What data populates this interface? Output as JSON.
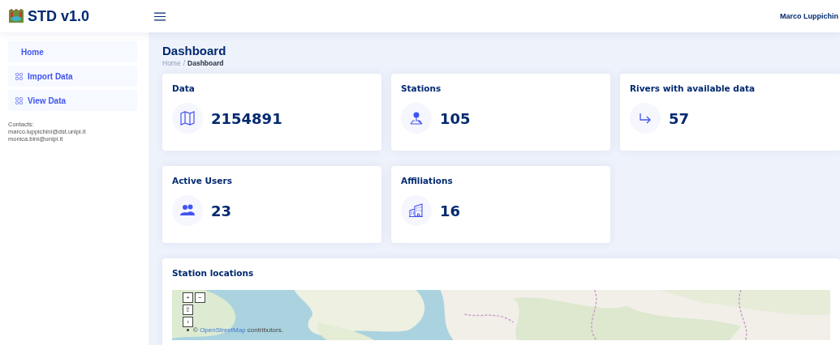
{
  "brand": {
    "title": "STD v1.0"
  },
  "header": {
    "user": "Marco Luppichin"
  },
  "sidebar": {
    "items": [
      {
        "label": "Home",
        "kind": "plain"
      },
      {
        "label": "Import Data",
        "kind": "grid"
      },
      {
        "label": "View Data",
        "kind": "grid"
      }
    ],
    "contacts": [
      "Contacts:",
      "marco.luppichini@dst.unipi.it",
      "monica.bini@unipi.it"
    ]
  },
  "page": {
    "title": "Dashboard",
    "breadcrumb_separator": "/",
    "breadcrumb": [
      {
        "label": "Home",
        "kind": "link"
      },
      {
        "label": "Dashboard",
        "kind": "current"
      }
    ]
  },
  "cards": [
    {
      "title": "Data",
      "value": "2154891"
    },
    {
      "title": "Stations",
      "value": "105"
    },
    {
      "title": "Rivers with available data",
      "value": "57"
    },
    {
      "title": "Active Users",
      "value": "23"
    },
    {
      "title": "Affiliations",
      "value": "16"
    }
  ],
  "map_card": {
    "title": "Station locations",
    "controls": [
      "+",
      "−",
      "⇧",
      "›"
    ],
    "attribution": {
      "prefix": "© ",
      "link": "OpenStreetMap",
      "suffix": " contributors."
    }
  }
}
